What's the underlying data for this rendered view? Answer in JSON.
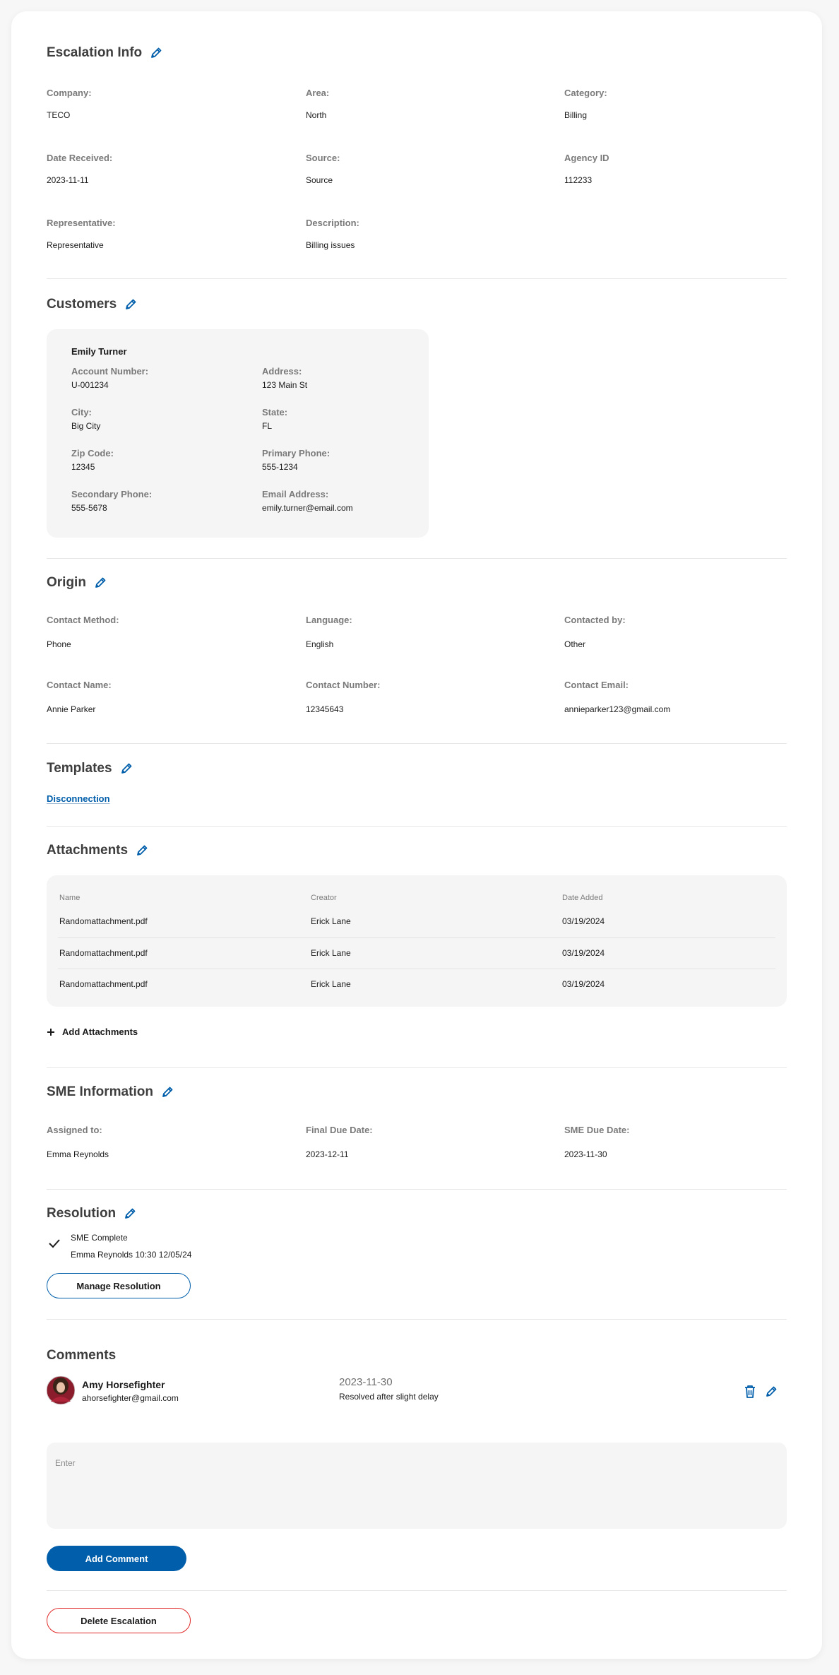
{
  "escalation": {
    "title": "Escalation Info",
    "fields": [
      {
        "label": "Company:",
        "value": "TECO"
      },
      {
        "label": "Area:",
        "value": "North"
      },
      {
        "label": "Category:",
        "value": "Billing"
      },
      {
        "label": "Date Received:",
        "value": "2023-11-11"
      },
      {
        "label": "Source:",
        "value": "Source"
      },
      {
        "label": "Agency ID",
        "value": "112233"
      },
      {
        "label": "Representative:",
        "value": "Representative"
      },
      {
        "label": "Description:",
        "value": "Billing issues"
      }
    ]
  },
  "customers": {
    "title": "Customers",
    "name": "Emily Turner",
    "fields": [
      {
        "label": "Account Number:",
        "value": "U-001234"
      },
      {
        "label": "Address:",
        "value": "123 Main St"
      },
      {
        "label": "City:",
        "value": "Big City"
      },
      {
        "label": "State:",
        "value": "FL"
      },
      {
        "label": "Zip Code:",
        "value": "12345"
      },
      {
        "label": "Primary Phone:",
        "value": "555-1234"
      },
      {
        "label": "Secondary Phone:",
        "value": "555-5678"
      },
      {
        "label": "Email Address:",
        "value": "emily.turner@email.com"
      }
    ]
  },
  "origin": {
    "title": "Origin",
    "fields": [
      {
        "label": "Contact Method:",
        "value": "Phone"
      },
      {
        "label": "Language:",
        "value": "English"
      },
      {
        "label": "Contacted by:",
        "value": "Other"
      },
      {
        "label": "Contact Name:",
        "value": "Annie Parker"
      },
      {
        "label": "Contact Number:",
        "value": "12345643"
      },
      {
        "label": "Contact Email:",
        "value": "annieparker123@gmail.com"
      }
    ]
  },
  "templates": {
    "title": "Templates",
    "link": "Disconnection"
  },
  "attachments": {
    "title": "Attachments",
    "columns": [
      "Name",
      "Creator",
      "Date Added"
    ],
    "rows": [
      [
        "Randomattachment.pdf",
        "Erick Lane",
        "03/19/2024"
      ],
      [
        "Randomattachment.pdf",
        "Erick Lane",
        "03/19/2024"
      ],
      [
        "Randomattachment.pdf",
        "Erick Lane",
        "03/19/2024"
      ]
    ],
    "add_label": "Add Attachments"
  },
  "sme": {
    "title": "SME Information",
    "fields": [
      {
        "label": "Assigned to:",
        "value": "Emma Reynolds"
      },
      {
        "label": "Final Due Date:",
        "value": "2023-12-11"
      },
      {
        "label": "SME Due Date:",
        "value": "2023-11-30"
      }
    ]
  },
  "resolution": {
    "title": "Resolution",
    "status": "SME Complete",
    "detail": "Emma Reynolds 10:30 12/05/24",
    "button": "Manage Resolution"
  },
  "comments": {
    "title": "Comments",
    "author_name": "Amy Horsefighter",
    "author_email": "ahorsefighter@gmail.com",
    "date": "2023-11-30",
    "text": "Resolved after slight delay",
    "placeholder": "Enter",
    "add_button": "Add Comment"
  },
  "delete_button": "Delete Escalation",
  "colors": {
    "accent": "#005eab",
    "danger": "#e02828"
  }
}
